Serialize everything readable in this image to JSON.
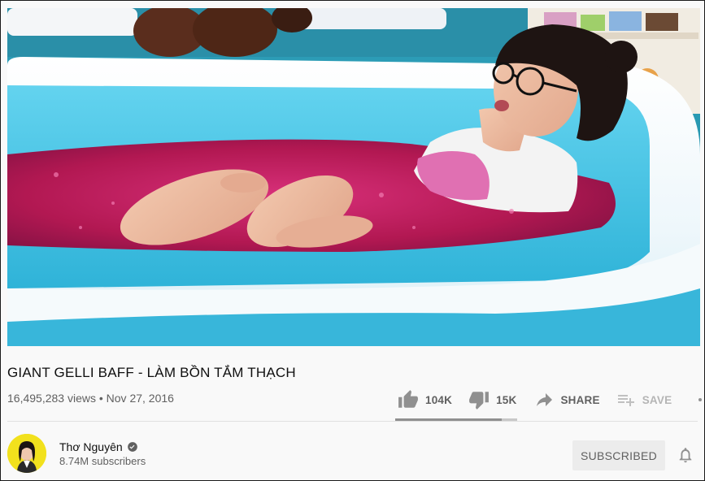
{
  "video": {
    "title": "GIANT GELLI BAFF - LÀM BỒN TẮM THẠCH",
    "views": "16,495,283 views",
    "separator": "•",
    "date": "Nov 27, 2016"
  },
  "actions": {
    "like_count": "104K",
    "dislike_count": "15K",
    "share_label": "SHARE",
    "save_label": "SAVE",
    "like_ratio": 0.87
  },
  "channel": {
    "name": "Thơ Nguyên",
    "verified_icon": "verified-check-icon",
    "subscribers": "8.74M subscribers",
    "subscribe_label": "SUBSCRIBED"
  },
  "colors": {
    "text_primary": "#0f0f0f",
    "text_secondary": "#606060",
    "icon": "#909090",
    "avatar_bg": "#f2e11d",
    "tub_blue": "#3bbfe0",
    "jelly_pink": "#c0205e"
  }
}
